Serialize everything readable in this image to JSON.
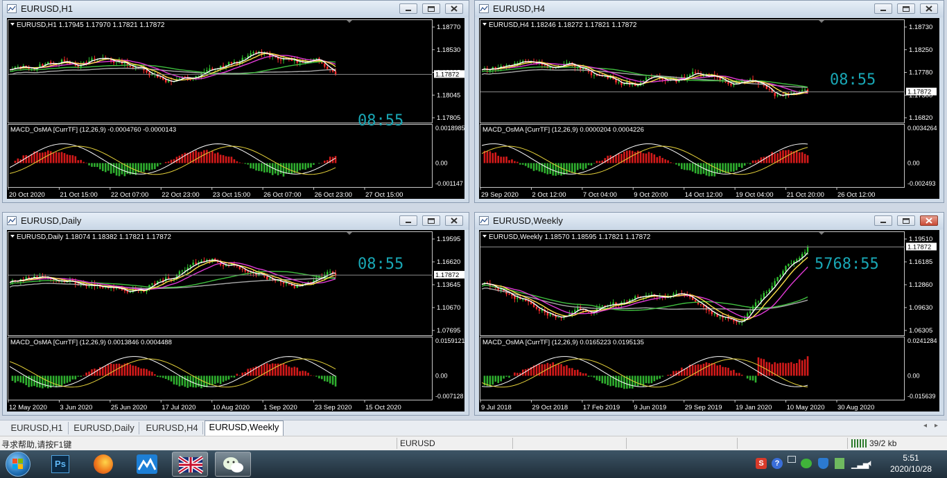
{
  "windows": [
    {
      "title": "EURUSD,H1",
      "info": "EURUSD,H1  1.17945 1.17970 1.17821 1.17872",
      "prices": [
        "1.18770",
        "1.18530",
        "1.18285",
        "1.18045",
        "1.17805"
      ],
      "current_price": "1.17872",
      "timer": "08:55",
      "macd_label": "MACD_OsMA [CurrTF] (12,26,9) -0.0004760 -0.0000143",
      "macd_axis": [
        "0.0018985",
        "0.00",
        "-0.001147"
      ],
      "dates": [
        "20 Oct 2020",
        "21 Oct 15:00",
        "22 Oct 07:00",
        "22 Oct 23:00",
        "23 Oct 15:00",
        "26 Oct 07:00",
        "26 Oct 23:00",
        "27 Oct 15:00"
      ]
    },
    {
      "title": "EURUSD,H4",
      "info": "EURUSD,H4  1.18246 1.18272 1.17821 1.17872",
      "prices": [
        "1.18730",
        "1.18250",
        "1.17780",
        "1.17300",
        "1.16820"
      ],
      "current_price": "1.17872",
      "timer": "08:55",
      "macd_label": "MACD_OsMA [CurrTF] (12,26,9) 0.0000204 0.0004226",
      "macd_axis": [
        "0.0034264",
        "0.00",
        "-0.002493"
      ],
      "dates": [
        "29 Sep 2020",
        "2 Oct 12:00",
        "7 Oct 04:00",
        "9 Oct 20:00",
        "14 Oct 12:00",
        "19 Oct 04:00",
        "21 Oct 20:00",
        "26 Oct 12:00"
      ]
    },
    {
      "title": "EURUSD,Daily",
      "info": "EURUSD,Daily  1.18074 1.18382 1.17821 1.17872",
      "prices": [
        "1.19595",
        "1.16620",
        "1.13645",
        "1.10670",
        "1.07695"
      ],
      "current_price": "1.17872",
      "timer": "08:55",
      "macd_label": "MACD_OsMA [CurrTF] (12,26,9) 0.0013846 0.0004488",
      "macd_axis": [
        "0.0159121",
        "0.00",
        "-0.007128"
      ],
      "dates": [
        "12 May 2020",
        "3 Jun 2020",
        "25 Jun 2020",
        "17 Jul 2020",
        "10 Aug 2020",
        "1 Sep 2020",
        "23 Sep 2020",
        "15 Oct 2020"
      ]
    },
    {
      "title": "EURUSD,Weekly",
      "info": "EURUSD,Weekly  1.18570 1.18595 1.17821 1.17872",
      "prices": [
        "1.19510",
        "1.16185",
        "1.12860",
        "1.09630",
        "1.06305"
      ],
      "current_price": "1.17872",
      "timer": "5768:55",
      "macd_label": "MACD_OsMA [CurrTF] (12,26,9) 0.0165223 0.0195135",
      "macd_axis": [
        "0.0241284",
        "0.00",
        "-0.015639"
      ],
      "dates": [
        "9 Jul 2018",
        "29 Oct 2018",
        "17 Feb 2019",
        "9 Jun 2019",
        "29 Sep 2019",
        "19 Jan 2020",
        "10 May 2020",
        "30 Aug 2020"
      ]
    }
  ],
  "tabs": [
    "EURUSD,H1",
    "EURUSD,Daily",
    "EURUSD,H4",
    "EURUSD,Weekly"
  ],
  "active_tab": "EURUSD,Weekly",
  "status": {
    "help": "寻求帮助,请按F1键",
    "symbol": "EURUSD",
    "traffic": "39/2 kb"
  },
  "clock": {
    "time": "5:51",
    "date": "2020/10/28"
  },
  "taskbar_apps": [
    "start-orb",
    "photoshop",
    "firefox",
    "trading-app",
    "uk-flag-app",
    "wechat"
  ],
  "colors": {
    "up_candle": "#2fc42f",
    "down_candle": "#ff2d2d",
    "ma_fast": "#ffffff",
    "ma_yellow": "#ffe14a",
    "ma_magenta": "#e23ad8",
    "ma_green": "#3fbf3f",
    "ma_gray": "#a8a8a8",
    "timer": "#19a7b5"
  }
}
